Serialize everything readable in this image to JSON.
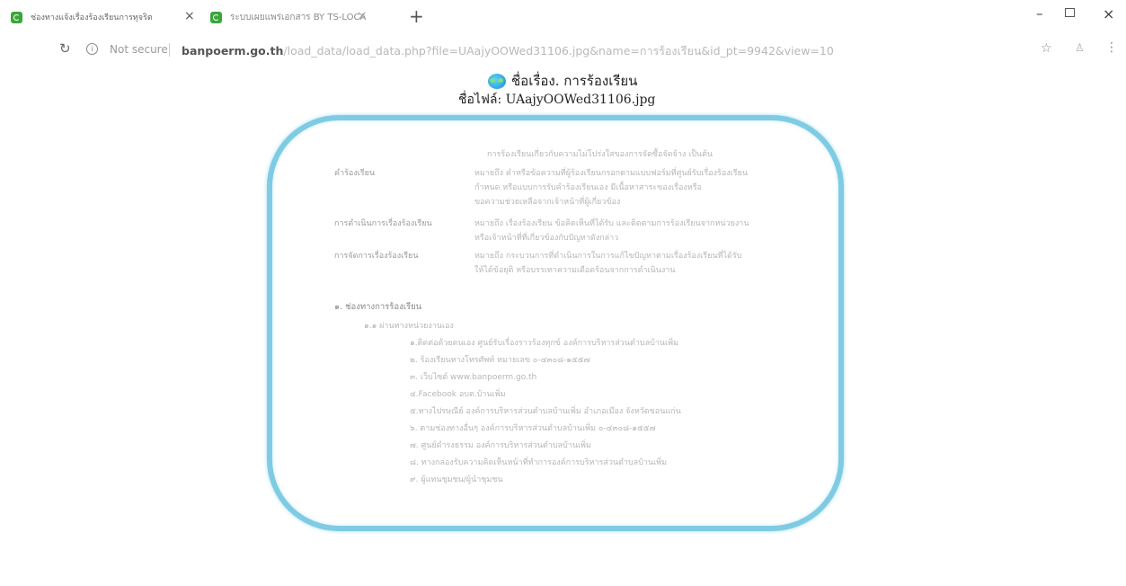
{
  "tabs": [
    {
      "title": "ช่องทางแจ้งเรื่องร้องเรียนการทุจริต"
    },
    {
      "title": "ระบบเผยแพร่เอกสาร BY TS-LOCA"
    }
  ],
  "address": {
    "security": "Not secure",
    "domain": "banpoerm.go.th",
    "path": "/load_data/load_data.php?file=UAajyOOWed31106.jpg&name=การร้องเรียน&id_pt=9942&view=10"
  },
  "page": {
    "title": "ชื่อเรื่อง. การร้องเรียน",
    "file_name": "ชื่อไฟล์: UAajyOOWed31106.jpg"
  },
  "document": {
    "intro": "การร้องเรียนเกี่ยวกับความไม่โปร่งใสของการจัดซื้อจัดจ้าง เป็นต้น",
    "definitions": [
      {
        "term": "คำร้องเรียน",
        "lines": [
          "หมายถึง คำหรือข้อความที่ผู้ร้องเรียนกรอกตามแบบฟอร์มที่ศูนย์รับเรื่องร้องเรียน",
          "กำหนด หรือแบบการรับคำร้องเรียนเอง มีเนื้อหาสาระของเรื่องหรือ",
          "ขอความช่วยเหลือจากเจ้าหน้าที่ผู้เกี่ยวข้อง"
        ]
      },
      {
        "term": "การดำเนินการเรื่องร้องเรียน",
        "lines": [
          "หมายถึง เรื่องร้องเรียน ข้อคิดเห็นที่ได้รับ และติดตามการร้องเรียนจากหน่วยงาน",
          "หรือเจ้าหน้าที่ที่เกี่ยวข้องกับปัญหาดังกล่าว"
        ]
      },
      {
        "term": "การจัดการเรื่องร้องเรียน",
        "lines": [
          "หมายถึง กระบวนการที่ดำเนินการในการแก้ไขปัญหาตามเรื่องร้องเรียนที่ได้รับ",
          "ให้ได้ข้อยุติ หรือบรรเทาความเดือดร้อนจากการดำเนินงาน"
        ]
      }
    ],
    "section_heading": "๑. ช่องทางการร้องเรียน",
    "subsection_heading": "๑.๑ ผ่านทางหน่วยงานเอง",
    "channels": [
      "๑.ติดต่อด้วยตนเอง ศูนย์รับเรื่องราวร้องทุกข์ องค์การบริหารส่วนตำบลบ้านเพิ่ม",
      "๒. ร้องเรียนทางโทรศัพท์ หมายเลข ๐-๔๓๐๘-๑๕๕๗",
      "๓. เว็บไซต์ www.banpoerm.go.th",
      "๔.Facebook อบต.บ้านเพิ่ม",
      "๕.ทางไปรษณีย์ องค์การบริหารส่วนตำบลบ้านเพิ่ม อำเภอเมือง จังหวัดขอนแก่น",
      "๖. ตามช่องทางอื่นๆ องค์การบริหารส่วนตำบลบ้านเพิ่ม ๐-๔๓๐๘-๑๕๕๗",
      "๗. ศูนย์ดำรงธรรม องค์การบริหารส่วนตำบลบ้านเพิ่ม",
      "๘. ทางกล่องรับความคิดเห็นหน้าที่ทำการองค์การบริหารส่วนตำบลบ้านเพิ่ม",
      "๙. ผู้แทนชุมชน/ผู้นำชุมชน"
    ]
  }
}
